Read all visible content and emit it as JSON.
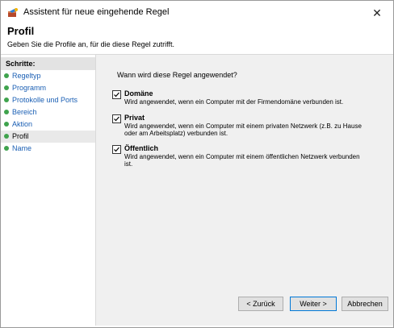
{
  "window": {
    "title": "Assistent für neue eingehende Regel",
    "close_label": "✕"
  },
  "header": {
    "title": "Profil",
    "subtitle": "Geben Sie die Profile an, für die diese Regel zutrifft."
  },
  "sidebar": {
    "heading": "Schritte:",
    "items": [
      {
        "label": "Regeltyp"
      },
      {
        "label": "Programm"
      },
      {
        "label": "Protokolle und Ports"
      },
      {
        "label": "Bereich"
      },
      {
        "label": "Aktion"
      },
      {
        "label": "Profil",
        "current": true
      },
      {
        "label": "Name"
      }
    ]
  },
  "main": {
    "question": "Wann wird diese Regel angewendet?",
    "options": [
      {
        "label": "Domäne",
        "checked": true,
        "description": "Wird angewendet, wenn ein Computer mit der Firmendomäne verbunden ist."
      },
      {
        "label": "Privat",
        "checked": true,
        "description": "Wird angewendet, wenn ein Computer mit einem privaten Netzwerk (z.B. zu Hause oder am Arbeitsplatz) verbunden ist."
      },
      {
        "label": "Öffentlich",
        "checked": true,
        "description": "Wird angewendet, wenn ein Computer mit einem öffentlichen Netzwerk verbunden ist."
      }
    ]
  },
  "buttons": {
    "back": "< Zurück",
    "next": "Weiter >",
    "cancel": "Abbrechen"
  },
  "colors": {
    "link": "#1a5fb4",
    "step_dot": "#3fa34d",
    "content_bg": "#f0f0f0",
    "default_button_border": "#0078d7"
  }
}
